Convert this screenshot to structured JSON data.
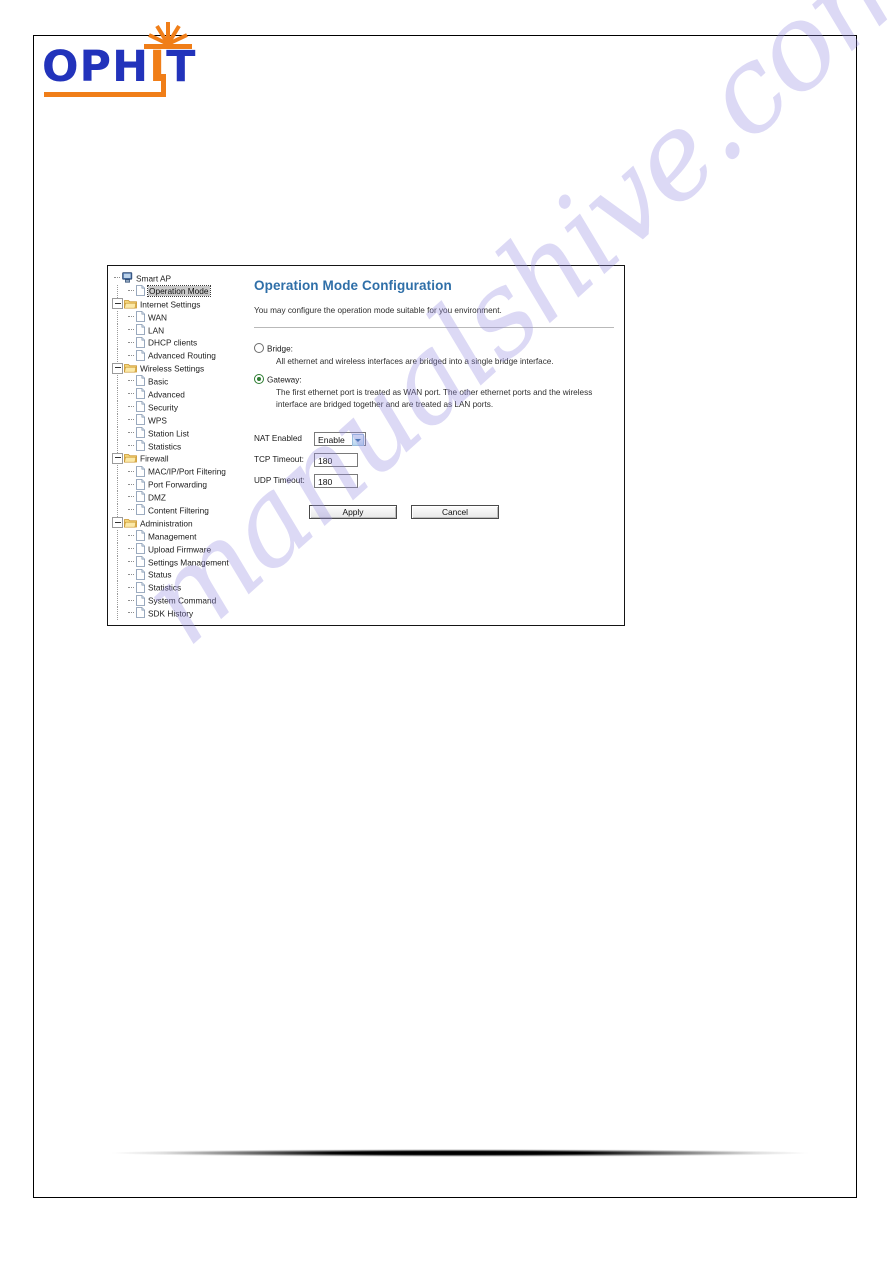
{
  "logo": {
    "text_left": "OPH",
    "text_i": "I",
    "text_right": "T",
    "brand_blue": "#2233bb",
    "brand_orange": "#f07e18"
  },
  "router_ui": {
    "tree": [
      {
        "label": "Smart AP",
        "icon": "computer-icon",
        "level": 0,
        "type": "root",
        "expander": "none",
        "selected": false
      },
      {
        "label": "Operation Mode",
        "icon": "page-icon",
        "level": 1,
        "type": "leaf",
        "expander": "dash",
        "selected": true
      },
      {
        "label": "Internet Settings",
        "icon": "folder-icon",
        "level": 0,
        "type": "folder",
        "expander": "minus",
        "selected": false
      },
      {
        "label": "WAN",
        "icon": "page-icon",
        "level": 1,
        "type": "leaf",
        "expander": "dash",
        "selected": false
      },
      {
        "label": "LAN",
        "icon": "page-icon",
        "level": 1,
        "type": "leaf",
        "expander": "dash",
        "selected": false
      },
      {
        "label": "DHCP clients",
        "icon": "page-icon",
        "level": 1,
        "type": "leaf",
        "expander": "dash",
        "selected": false
      },
      {
        "label": "Advanced Routing",
        "icon": "page-icon",
        "level": 1,
        "type": "leaf",
        "expander": "dash",
        "selected": false
      },
      {
        "label": "Wireless Settings",
        "icon": "folder-icon",
        "level": 0,
        "type": "folder",
        "expander": "minus",
        "selected": false
      },
      {
        "label": "Basic",
        "icon": "page-icon",
        "level": 1,
        "type": "leaf",
        "expander": "dash",
        "selected": false
      },
      {
        "label": "Advanced",
        "icon": "page-icon",
        "level": 1,
        "type": "leaf",
        "expander": "dash",
        "selected": false
      },
      {
        "label": "Security",
        "icon": "page-icon",
        "level": 1,
        "type": "leaf",
        "expander": "dash",
        "selected": false
      },
      {
        "label": "WPS",
        "icon": "page-icon",
        "level": 1,
        "type": "leaf",
        "expander": "dash",
        "selected": false
      },
      {
        "label": "Station List",
        "icon": "page-icon",
        "level": 1,
        "type": "leaf",
        "expander": "dash",
        "selected": false
      },
      {
        "label": "Statistics",
        "icon": "page-icon",
        "level": 1,
        "type": "leaf",
        "expander": "dash",
        "selected": false
      },
      {
        "label": "Firewall",
        "icon": "folder-icon",
        "level": 0,
        "type": "folder",
        "expander": "minus",
        "selected": false
      },
      {
        "label": "MAC/IP/Port Filtering",
        "icon": "page-icon",
        "level": 1,
        "type": "leaf",
        "expander": "dash",
        "selected": false
      },
      {
        "label": "Port Forwarding",
        "icon": "page-icon",
        "level": 1,
        "type": "leaf",
        "expander": "dash",
        "selected": false
      },
      {
        "label": "DMZ",
        "icon": "page-icon",
        "level": 1,
        "type": "leaf",
        "expander": "dash",
        "selected": false
      },
      {
        "label": "Content Filtering",
        "icon": "page-icon",
        "level": 1,
        "type": "leaf",
        "expander": "dash",
        "selected": false
      },
      {
        "label": "Administration",
        "icon": "folder-icon",
        "level": 0,
        "type": "folder",
        "expander": "minus",
        "selected": false
      },
      {
        "label": "Management",
        "icon": "page-icon",
        "level": 1,
        "type": "leaf",
        "expander": "dash",
        "selected": false
      },
      {
        "label": "Upload Firmware",
        "icon": "page-icon",
        "level": 1,
        "type": "leaf",
        "expander": "dash",
        "selected": false
      },
      {
        "label": "Settings Management",
        "icon": "page-icon",
        "level": 1,
        "type": "leaf",
        "expander": "dash",
        "selected": false
      },
      {
        "label": "Status",
        "icon": "page-icon",
        "level": 1,
        "type": "leaf",
        "expander": "dash",
        "selected": false
      },
      {
        "label": "Statistics",
        "icon": "page-icon",
        "level": 1,
        "type": "leaf",
        "expander": "dash",
        "selected": false
      },
      {
        "label": "System Command",
        "icon": "page-icon",
        "level": 1,
        "type": "leaf",
        "expander": "dash",
        "selected": false
      },
      {
        "label": "SDK History",
        "icon": "page-icon",
        "level": 1,
        "type": "leaf",
        "expander": "dash",
        "selected": false
      }
    ],
    "content": {
      "title": "Operation Mode Configuration",
      "title_color": "#2f6fa8",
      "description": "You may configure the operation mode suitable for you environment.",
      "modes": [
        {
          "label": "Bridge:",
          "selected": false,
          "description": "All ethernet and wireless interfaces are bridged into a single bridge interface."
        },
        {
          "label": "Gateway:",
          "selected": true,
          "description": "The first ethernet port is treated as WAN port. The other ethernet ports and the wireless interface are bridged together and are treated as LAN ports."
        }
      ],
      "fields": [
        {
          "label": "NAT Enabled",
          "type": "select",
          "value": "Enable"
        },
        {
          "label": "TCP Timeout:",
          "type": "text",
          "value": "180"
        },
        {
          "label": "UDP Timeout:",
          "type": "text",
          "value": "180"
        }
      ],
      "buttons": {
        "apply": "Apply",
        "cancel": "Cancel"
      }
    }
  },
  "watermark": {
    "text": "manualshive.com"
  }
}
